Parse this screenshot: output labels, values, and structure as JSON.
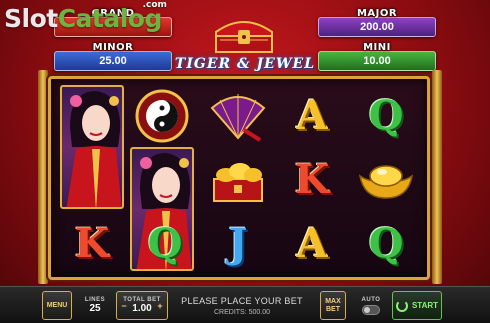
{
  "watermark": {
    "part1": "Slot",
    "part2": "Catalog",
    "suffix": ".com"
  },
  "jackpots": {
    "grand": {
      "label": "GRAND",
      "value": ""
    },
    "minor": {
      "label": "MINOR",
      "value": "25.00"
    },
    "major": {
      "label": "MAJOR",
      "value": "200.00"
    },
    "mini": {
      "label": "MINI",
      "value": "10.00"
    }
  },
  "logo": {
    "title": "TIGER & JEWEL",
    "icon": "treasure-chest-icon"
  },
  "reels": {
    "stacked_symbol": "geisha-wild",
    "cells": [
      {
        "name": "reel-2-row-1",
        "symbol": "yin-yang-icon"
      },
      {
        "name": "reel-3-row-1",
        "symbol": "fan-icon"
      },
      {
        "name": "reel-4-row-1",
        "symbol": "A",
        "color": "gold"
      },
      {
        "name": "reel-5-row-1",
        "symbol": "Q",
        "color": "green"
      },
      {
        "name": "reel-3-row-2",
        "symbol": "gold-treasure-box-icon"
      },
      {
        "name": "reel-4-row-2",
        "symbol": "K",
        "color": "red"
      },
      {
        "name": "reel-5-row-2",
        "symbol": "gold-ingot-icon"
      },
      {
        "name": "reel-1-row-3",
        "symbol": "K",
        "color": "red"
      },
      {
        "name": "reel-2-row-3",
        "symbol": "Q",
        "color": "green"
      },
      {
        "name": "reel-3-row-3",
        "symbol": "J",
        "color": "blue"
      },
      {
        "name": "reel-4-row-3",
        "symbol": "A",
        "color": "gold"
      },
      {
        "name": "reel-5-row-3",
        "symbol": "Q",
        "color": "green"
      }
    ]
  },
  "controls": {
    "menu": "MENU",
    "lines_label": "LINES",
    "lines_value": "25",
    "total_bet_label": "TOTAL BET",
    "total_bet_value": "1.00",
    "minus": "−",
    "plus": "+",
    "message": "PLEASE PLACE YOUR BET",
    "credits": "CREDITS: 500.00",
    "max_bet": "MAX BET",
    "auto_label": "AUTO",
    "start": "START"
  },
  "colors": {
    "frame_gold": "#d9a43a",
    "background_red": "#c8191f",
    "start_green": "#8ef07a"
  }
}
